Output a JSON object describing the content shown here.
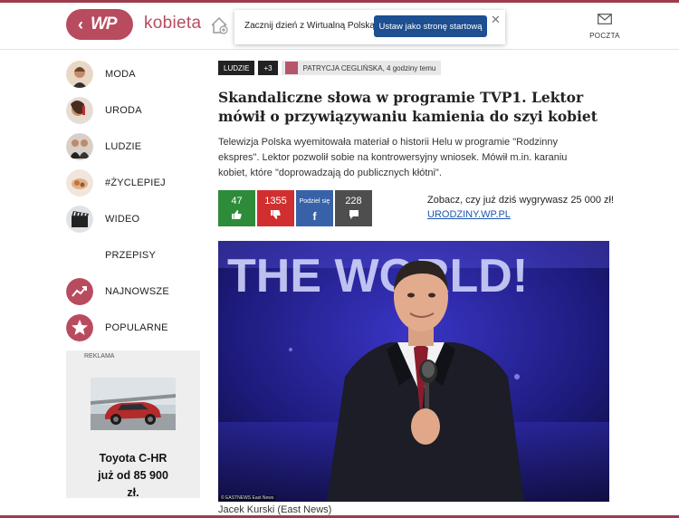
{
  "header": {
    "brand": "kobieta",
    "popup_text": "Zacznij dzień z Wirtualną Polską.",
    "popup_button": "Ustaw jako stronę startową",
    "mail_label": "POCZTA"
  },
  "sidebar": {
    "items": [
      {
        "label": "MODA"
      },
      {
        "label": "URODA"
      },
      {
        "label": "LUDZIE"
      },
      {
        "label": "#ŻYCLEPIEJ"
      },
      {
        "label": "WIDEO"
      },
      {
        "label": "PRZEPISY"
      },
      {
        "label": "NAJNOWSZE"
      },
      {
        "label": "POPULARNE"
      }
    ]
  },
  "ad": {
    "label": "REKLAMA",
    "line1": "Toyota C-HR",
    "line2": "już od 85 900",
    "line3": "zł."
  },
  "article": {
    "tag": "LUDZIE",
    "more_tags": "+3",
    "author": "PATRYCJA CEGLIŃSKA,  4 godziny temu",
    "title": "Skandaliczne słowa w programie TVP1. Lektor mówił o przywiązywaniu kamienia do szyi kobiet",
    "lead": "Telewizja Polska wyemitowała materiał o historii Helu w programie \"Rodzinny ekspres\". Lektor pozwolił sobie na kontrowersyjny wniosek. Mówił m.in. karaniu kobiet, które \"doprowadzają do publicznych kłótni\".",
    "votes": {
      "likes": "47",
      "dislikes": "1355",
      "share_label": "Podziel się",
      "comments": "228"
    },
    "promo_text": "Zobacz, czy już dziś wygrywasz 25 000 zł!",
    "promo_link": "URODZINY.WP.PL",
    "photo_backdrop": "THE WORLD!",
    "photo_credit": "© EASTNEWS East News",
    "caption": "Jacek Kurski (East News)"
  },
  "colors": {
    "brand": "#b94b5f",
    "like": "#2d8b3a",
    "dislike": "#d12f2f",
    "share": "#3862a8",
    "comments": "#4e4e4e",
    "link": "#1f56b0"
  }
}
